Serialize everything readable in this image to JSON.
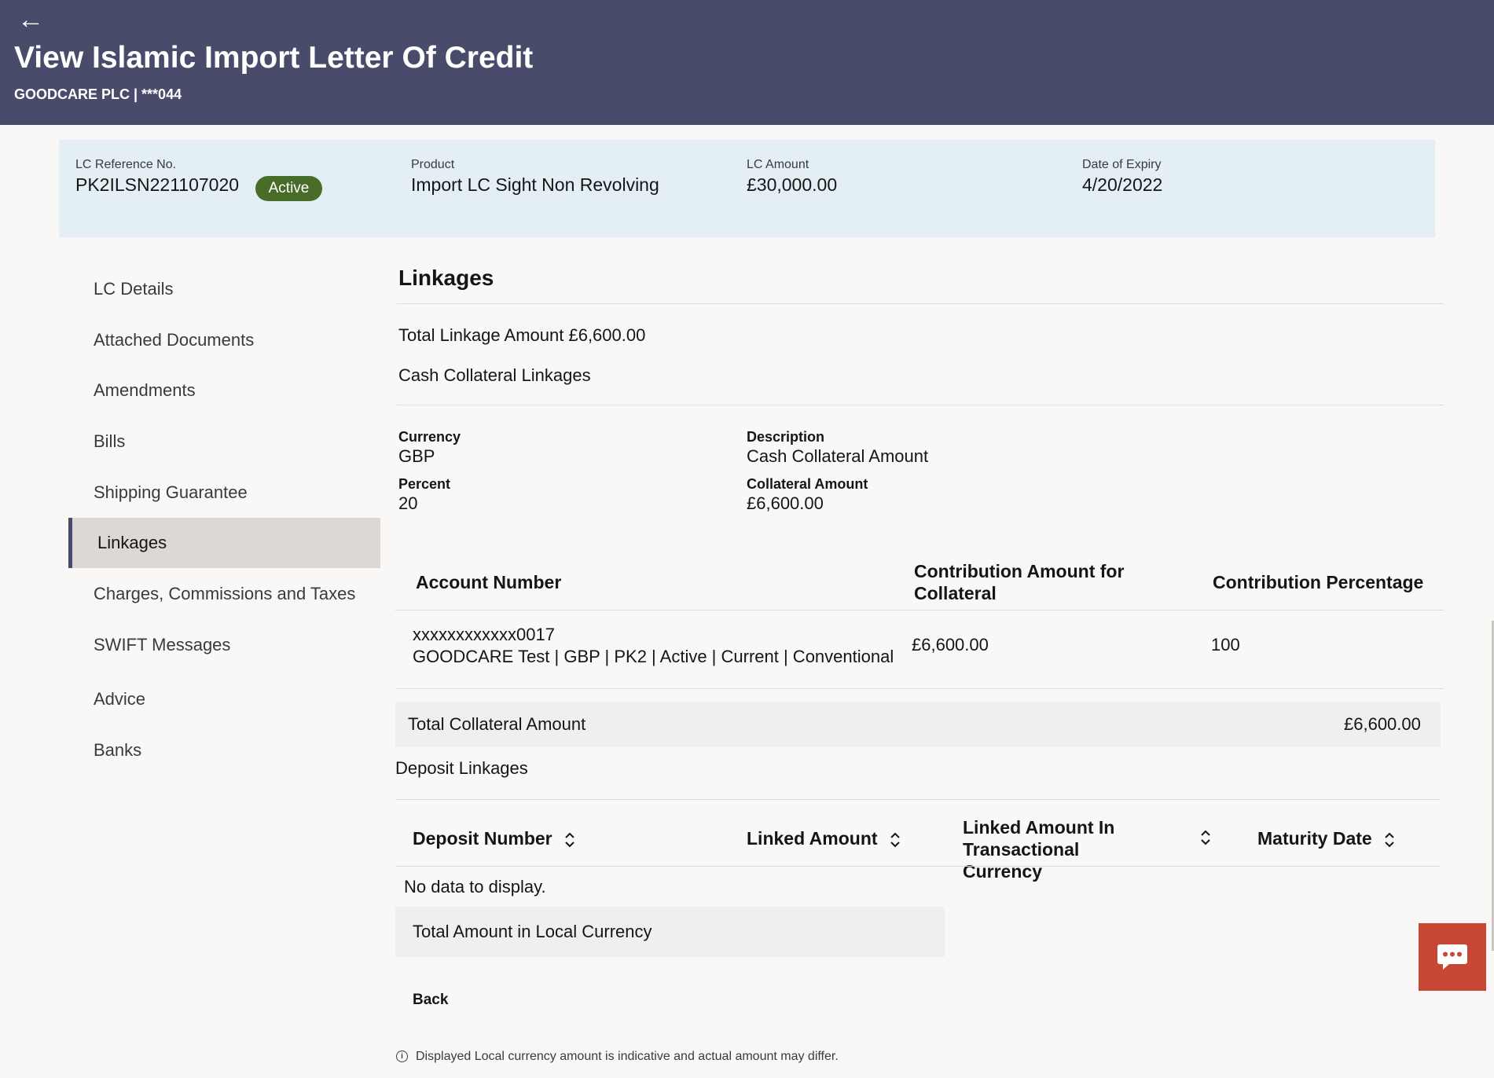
{
  "header": {
    "back_icon": "←",
    "title": "View Islamic Import Letter Of Credit",
    "party": "GOODCARE PLC | ***044"
  },
  "summary": {
    "ref_label": "LC Reference No.",
    "ref_value": "PK2ILSN221107020",
    "status": "Active",
    "product_label": "Product",
    "product_value": "Import LC Sight Non Revolving",
    "amount_label": "LC Amount",
    "amount_value": "£30,000.00",
    "expiry_label": "Date of Expiry",
    "expiry_value": "4/20/2022"
  },
  "sidebar": {
    "items": [
      {
        "label": "LC Details"
      },
      {
        "label": "Attached Documents"
      },
      {
        "label": "Amendments"
      },
      {
        "label": "Bills"
      },
      {
        "label": "Shipping Guarantee"
      },
      {
        "label": "Linkages"
      },
      {
        "label": "Charges, Commissions and Taxes"
      },
      {
        "label": "SWIFT Messages"
      },
      {
        "label": "Advice"
      },
      {
        "label": "Banks"
      }
    ],
    "active": "Linkages"
  },
  "main": {
    "heading": "Linkages",
    "total_linkage": "Total Linkage Amount £6,600.00",
    "cash_section_title": "Cash Collateral Linkages",
    "fields": {
      "currency_label": "Currency",
      "currency_value": "GBP",
      "description_label": "Description",
      "description_value": "Cash Collateral Amount",
      "percent_label": "Percent",
      "percent_value": "20",
      "collateral_label": "Collateral Amount",
      "collateral_value": "£6,600.00"
    },
    "collateral_table": {
      "headers": [
        "Account Number",
        "Contribution Amount for Collateral",
        "Contribution Percentage"
      ],
      "rows": [
        {
          "account_number": "xxxxxxxxxxxx0017",
          "account_details": "GOODCARE Test | GBP | PK2 | Active | Current | Conventional",
          "contribution_amount": "£6,600.00",
          "contribution_percentage": "100"
        }
      ]
    },
    "total_collateral_label": "Total Collateral Amount",
    "total_collateral_value": "£6,600.00",
    "deposit_section_title": "Deposit Linkages",
    "deposit_table": {
      "headers": [
        "Deposit Number",
        "Linked Amount",
        "Linked Amount In Transactional Currency",
        "Maturity Date"
      ],
      "empty_message": "No data to display."
    },
    "total_local_label": "Total Amount in Local Currency",
    "back_label": "Back",
    "footnote": "Displayed Local currency amount is indicative and actual amount may differ.",
    "info_icon": "i"
  },
  "colors": {
    "header_bg": "#484b69",
    "summary_bg": "#e3eff5",
    "status_badge": "#4a6c2a",
    "chat_button": "#c74634"
  },
  "icons": {
    "back": "back-arrow-icon",
    "sort": "sort-icon",
    "info": "info-icon",
    "chat": "chat-icon"
  }
}
